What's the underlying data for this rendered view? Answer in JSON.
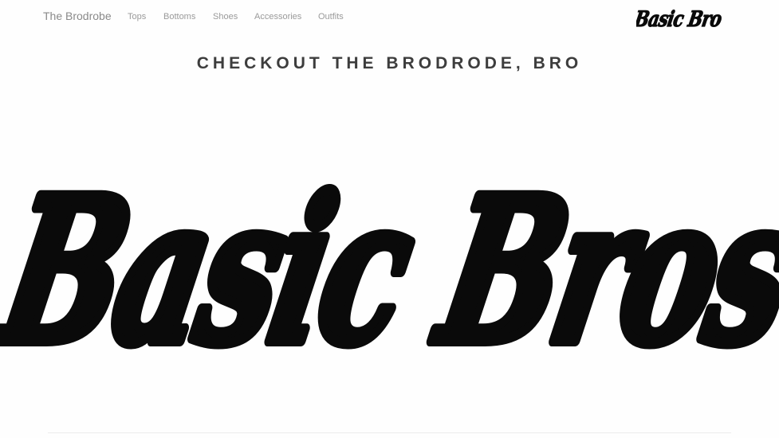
{
  "navbar": {
    "brand": "The Brodrobe",
    "links": [
      {
        "label": "Tops"
      },
      {
        "label": "Bottoms"
      },
      {
        "label": "Shoes"
      },
      {
        "label": "Accessories"
      },
      {
        "label": "Outfits"
      }
    ],
    "logo_text": "Basic Bro"
  },
  "hero": {
    "tagline": "CHECKOUT THE BRODRODE, BRO",
    "logo_text": "Basic Bros"
  },
  "colors": {
    "background": "#fefefe",
    "logo": "#0a0a0a",
    "nav_text": "#9a9a9a",
    "tagline": "#3d3d3d"
  }
}
